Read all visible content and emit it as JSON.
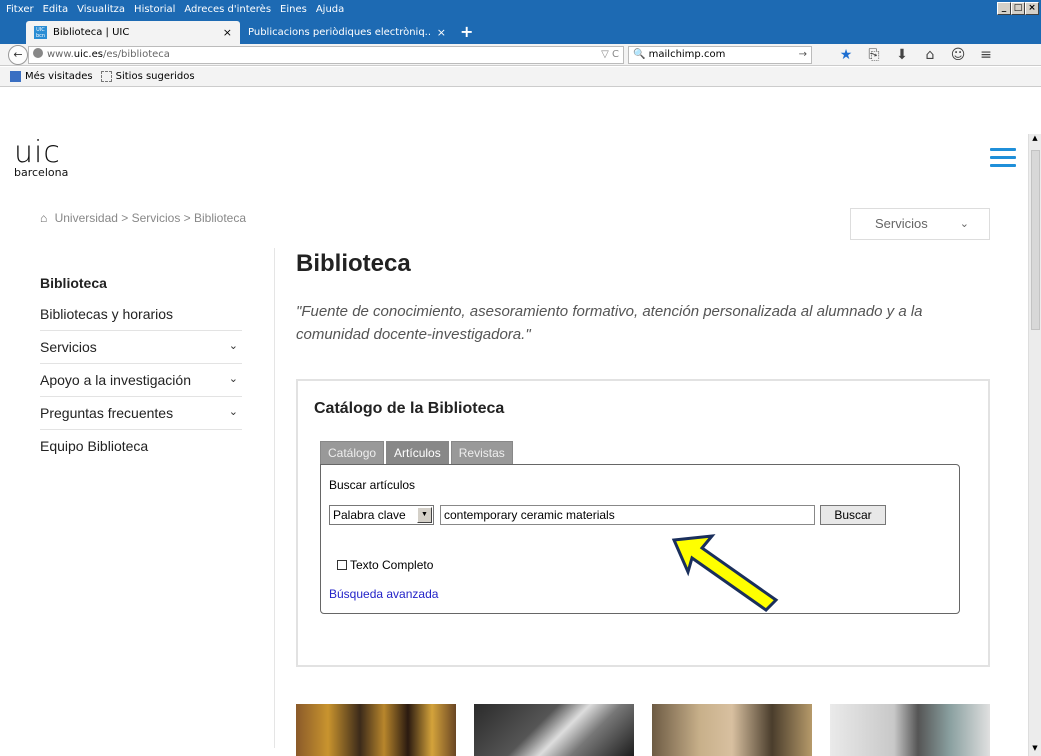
{
  "menubar": {
    "items": [
      "Fitxer",
      "Edita",
      "Visualitza",
      "Historial",
      "Adreces d'interès",
      "Eines",
      "Ajuda"
    ],
    "win_buttons": [
      "_",
      "□",
      "×"
    ]
  },
  "tabs": [
    {
      "favicon_text": "UIC bcn",
      "title": "Biblioteca | UIC",
      "close": "×"
    },
    {
      "title": "Publicacions periòdiques electròniq...",
      "close": "×"
    }
  ],
  "newtab": "+",
  "nav": {
    "back": "←",
    "url_prefix": "www.",
    "url_domain": "uic.es",
    "url_path": "/es/biblioteca",
    "url_right": "▽ C",
    "search_value": "mailchimp.com",
    "search_go": "→",
    "icons": [
      "★",
      "⎘",
      "⬇",
      "⌂",
      "☺",
      "≡"
    ]
  },
  "bookmarks": {
    "most_visited": "Més visitades",
    "suggested": "Sitios sugeridos"
  },
  "site": {
    "logo_main": "uic",
    "logo_sub": "barcelona",
    "breadcrumb_home": "⌂",
    "breadcrumb": "Universidad > Servicios > Biblioteca",
    "services_dropdown": "Servicios",
    "services_chevron": "⌄"
  },
  "sidebar": {
    "heading": "Biblioteca",
    "items": [
      {
        "label": "Bibliotecas y horarios",
        "chevron": ""
      },
      {
        "label": "Servicios",
        "chevron": "⌄"
      },
      {
        "label": "Apoyo a la investigación",
        "chevron": "⌄"
      },
      {
        "label": "Preguntas frecuentes",
        "chevron": "⌄"
      },
      {
        "label": "Equipo Biblioteca",
        "chevron": ""
      }
    ]
  },
  "main": {
    "title": "Biblioteca",
    "lead": "\"Fuente de conocimiento, asesoramiento formativo, atención personalizada al alumnado y a la comunidad docente-investigadora.\""
  },
  "catalog": {
    "title": "Catálogo de la Biblioteca",
    "tabs": [
      "Catálogo",
      "Artículos",
      "Revistas"
    ],
    "search_label": "Buscar artículos",
    "select_value": "Palabra clave",
    "select_arrow": "▼",
    "query_value": "contemporary ceramic materials",
    "button": "Buscar",
    "checkbox_label": "Texto Completo",
    "advanced_link": "Búsqueda avanzada"
  },
  "colors": {
    "firefox_blue": "#1d6ab3",
    "accent_blue": "#1f8fd9",
    "arrow_yellow": "#ffff00",
    "arrow_outline": "#1a2f5c"
  }
}
